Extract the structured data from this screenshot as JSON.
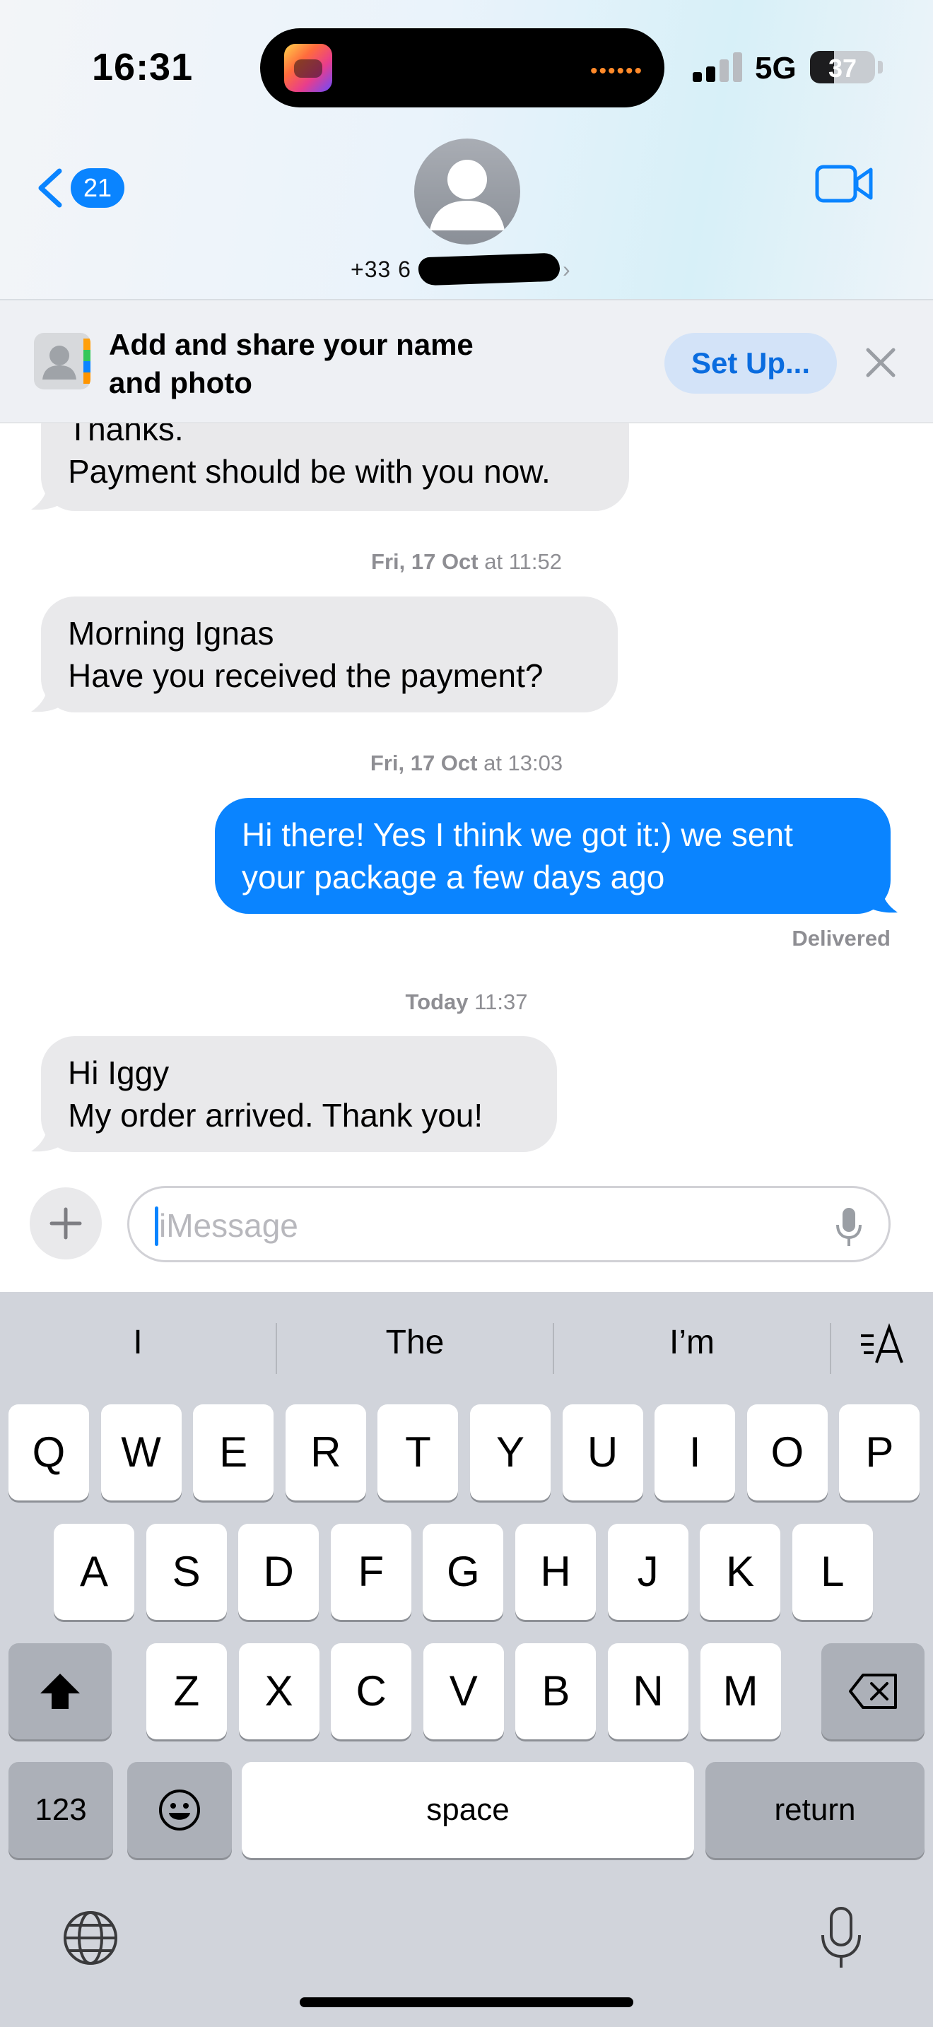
{
  "status_bar": {
    "time": "16:31",
    "network": "5G",
    "battery": "37",
    "battery_level": 0.37
  },
  "header": {
    "back_badge": "21",
    "contact_number": "+33 6"
  },
  "share_banner": {
    "title": "Add and share your name and photo",
    "setup_label": "Set Up..."
  },
  "messages": [
    {
      "direction": "incoming",
      "lines": [
        "Thanks.",
        "Payment should be with you now."
      ]
    },
    {
      "timestamp_day": "Fri, 17 Oct",
      "timestamp_time": " at 11:52"
    },
    {
      "direction": "incoming",
      "lines": [
        "Morning Ignas",
        "Have you received the payment?"
      ]
    },
    {
      "timestamp_day": "Fri, 17 Oct",
      "timestamp_time": " at 13:03"
    },
    {
      "direction": "outgoing",
      "lines": [
        "Hi there! Yes I think we got it:) we sent",
        "your package a few days ago"
      ],
      "status": "Delivered"
    },
    {
      "timestamp_day": "Today",
      "timestamp_time": " 11:37"
    },
    {
      "direction": "incoming",
      "lines": [
        "Hi Iggy",
        "My order arrived. Thank you!"
      ]
    }
  ],
  "composer": {
    "placeholder": "iMessage"
  },
  "keyboard": {
    "suggestions": [
      "I",
      "The",
      "I’m"
    ],
    "row1": [
      "Q",
      "W",
      "E",
      "R",
      "T",
      "Y",
      "U",
      "I",
      "O",
      "P"
    ],
    "row2": [
      "A",
      "S",
      "D",
      "F",
      "G",
      "H",
      "J",
      "K",
      "L"
    ],
    "row3": [
      "Z",
      "X",
      "C",
      "V",
      "B",
      "N",
      "M"
    ],
    "numbers_key": "123",
    "space_key": "space",
    "return_key": "return"
  },
  "colors": {
    "accent": "#0a84ff",
    "incoming_bubble": "#e9e9eb",
    "keyboard_bg": "#d1d4db"
  }
}
